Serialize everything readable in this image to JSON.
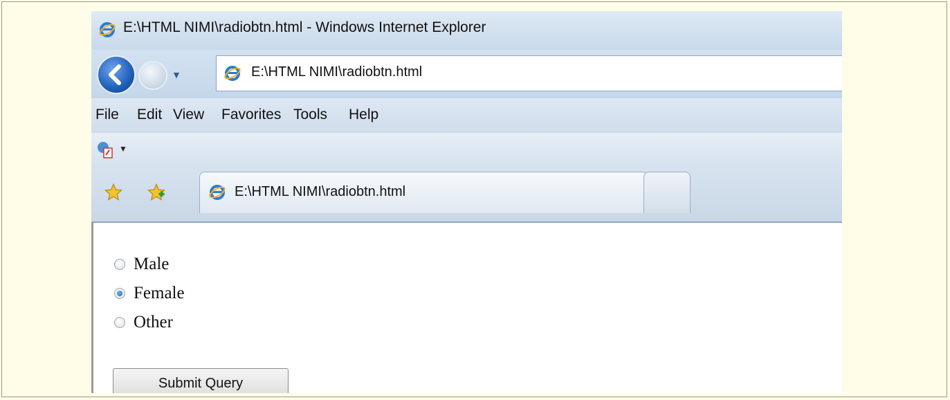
{
  "window": {
    "title": "E:\\HTML NIMI\\radiobtn.html - Windows Internet Explorer"
  },
  "address_bar": {
    "url": "E:\\HTML NIMI\\radiobtn.html"
  },
  "menu": {
    "items": [
      "File",
      "Edit",
      "View",
      "Favorites",
      "Tools",
      "Help"
    ]
  },
  "tab": {
    "label": "E:\\HTML NIMI\\radiobtn.html"
  },
  "form": {
    "options": [
      {
        "label": "Male",
        "checked": false
      },
      {
        "label": "Female",
        "checked": true
      },
      {
        "label": "Other",
        "checked": false
      }
    ],
    "submit_label": "Submit Query"
  },
  "colors": {
    "page_background": "#fffde7",
    "chrome_blue": "#c8d9ea",
    "radio_selected": "#1f5faa"
  }
}
